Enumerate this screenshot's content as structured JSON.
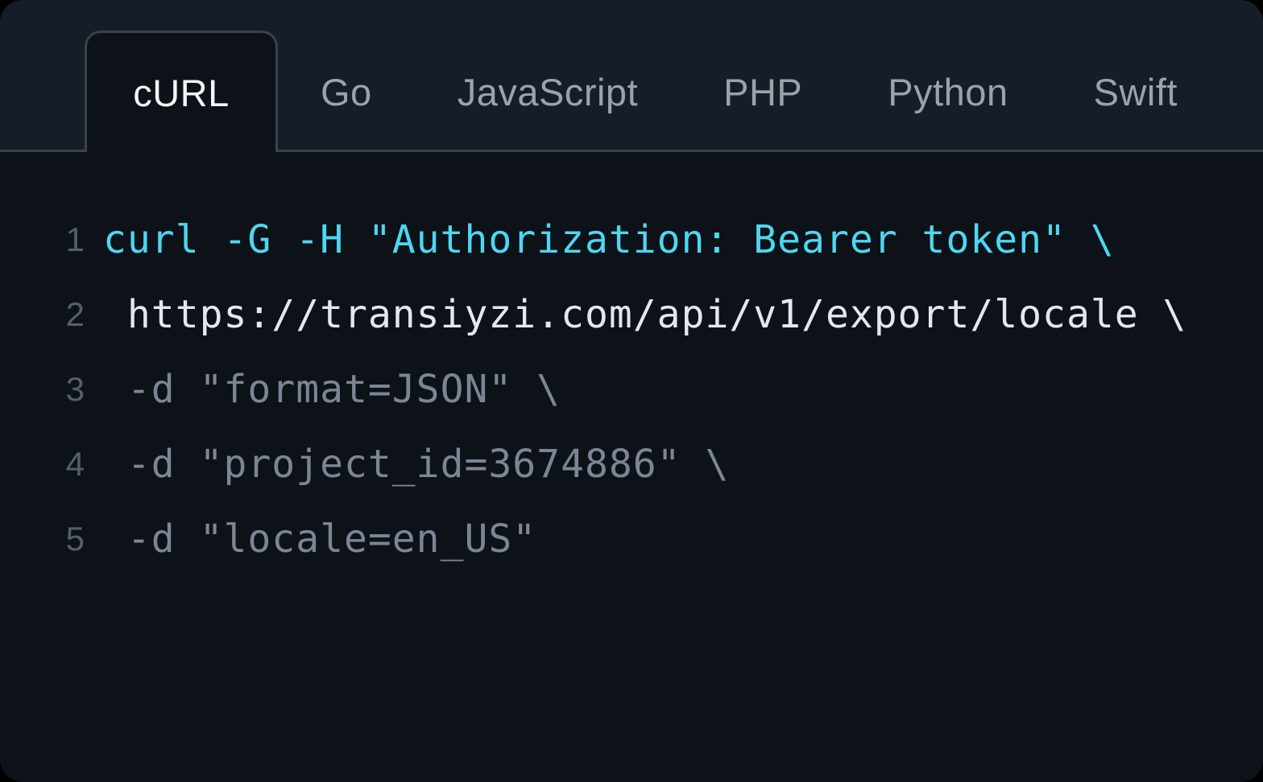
{
  "colors": {
    "card-bg": "#0d1118",
    "tabbar-bg": "#161d27",
    "border": "#3a424d",
    "tab-active-text": "#f3f5f7",
    "tab-inactive-text": "#9ba2aa",
    "line-number": "#555e69",
    "code-command": "#4dd7f0",
    "code-url": "#e4e8ec",
    "code-param": "#7d8595"
  },
  "tabs": [
    {
      "label": "cURL",
      "active": true
    },
    {
      "label": "Go",
      "active": false
    },
    {
      "label": "JavaScript",
      "active": false
    },
    {
      "label": "PHP",
      "active": false
    },
    {
      "label": "Python",
      "active": false
    },
    {
      "label": "Swift",
      "active": false
    }
  ],
  "code": {
    "language": "cURL",
    "lines": [
      {
        "number": "1",
        "text": "curl -G -H \"Authorization: Bearer token\" \\",
        "tone": "command"
      },
      {
        "number": "2",
        "text": " https://transiyzi.com/api/v1/export/locale \\",
        "tone": "url"
      },
      {
        "number": "3",
        "text": " -d \"format=JSON\" \\",
        "tone": "param"
      },
      {
        "number": "4",
        "text": " -d \"project_id=3674886\" \\",
        "tone": "param"
      },
      {
        "number": "5",
        "text": " -d \"locale=en_US\"",
        "tone": "param"
      }
    ]
  }
}
